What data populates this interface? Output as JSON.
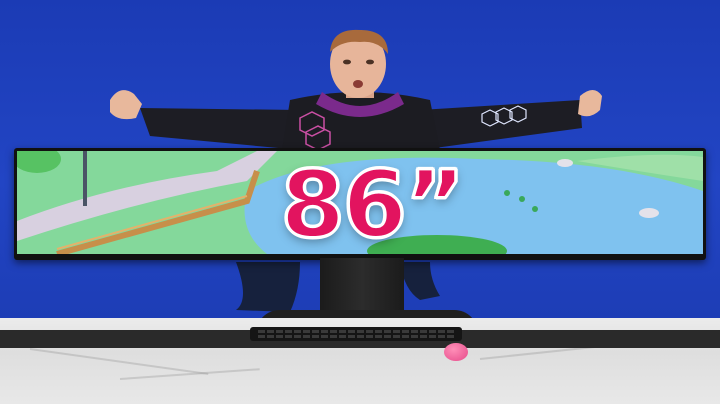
{
  "thumbnail": {
    "headline": "86”",
    "colors": {
      "background": "#1e3fb8",
      "headline": "#e2145f",
      "headline_outline": "#ffffff",
      "mouse": "#e64a8a"
    }
  }
}
